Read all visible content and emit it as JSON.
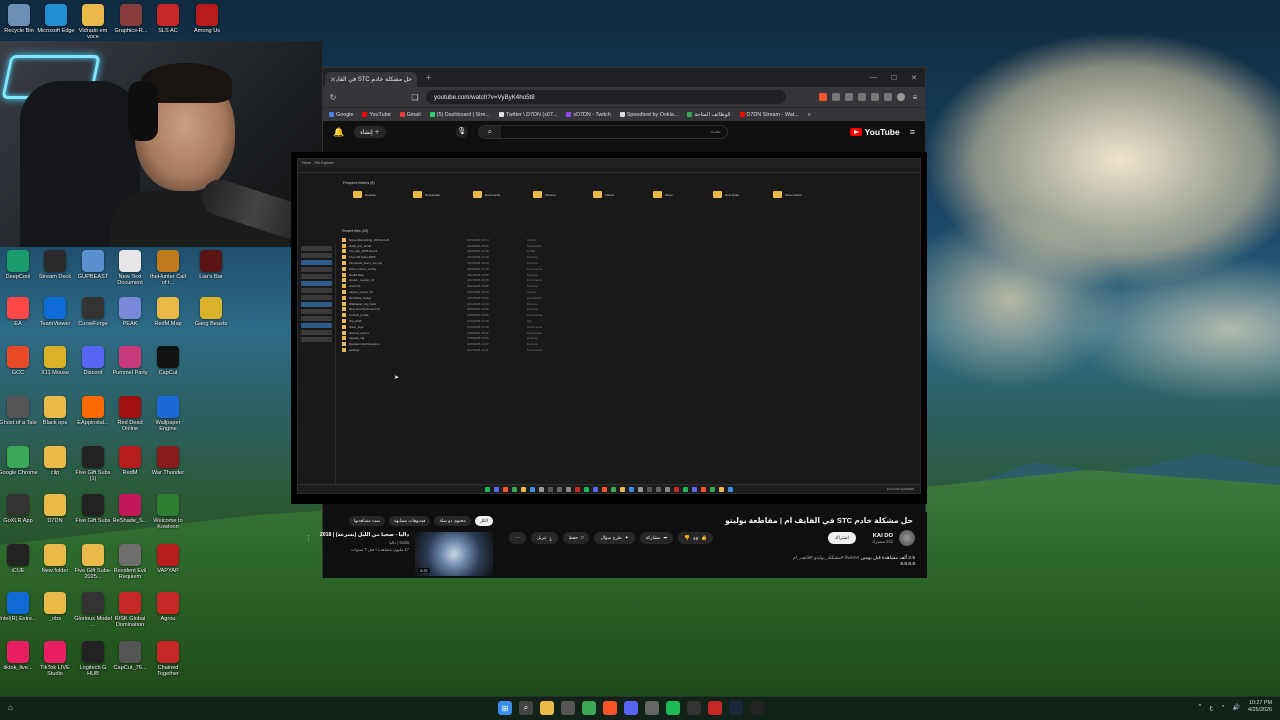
{
  "desktop": {
    "top_icons": [
      {
        "label": "Recycle Bin",
        "icon": "recycle-bin-icon",
        "color": "#6d8fb3"
      },
      {
        "label": "Microsoft Edge",
        "icon": "edge-icon",
        "color": "#1f8fd1"
      },
      {
        "label": "Vidrado em voce",
        "icon": "folder-icon",
        "color": "#e9b949"
      },
      {
        "label": "Graphics-R...",
        "icon": "graphics-icon",
        "color": "#8a3c3c"
      },
      {
        "label": "SLS AC",
        "icon": "sls-icon",
        "color": "#c62828"
      },
      {
        "label": "Among Us",
        "icon": "among-us-icon",
        "color": "#b71c1c"
      }
    ],
    "icons": [
      {
        "label": "DeepCool",
        "icon": "deepcool-icon",
        "color": "#1a9d6b"
      },
      {
        "label": "Stream Deck",
        "icon": "stream-deck-icon",
        "color": "#2a2a2a"
      },
      {
        "label": "GUPBEAST",
        "icon": "gupbeast-icon",
        "color": "#5a8fd0"
      },
      {
        "label": "New Text Document",
        "icon": "text-document-icon",
        "color": "#e6e6e6"
      },
      {
        "label": "theHunter Call of t...",
        "icon": "thehunter-icon",
        "color": "#c07a1b"
      },
      {
        "label": "Liar's Bar",
        "icon": "liars-bar-icon",
        "color": "#5a1414"
      },
      {
        "label": "EA",
        "icon": "ea-icon",
        "color": "#ff4747"
      },
      {
        "label": "TeamViewer",
        "icon": "teamviewer-icon",
        "color": "#0e6bd6"
      },
      {
        "label": "CurseForge",
        "icon": "curseforge-icon",
        "color": "#333333"
      },
      {
        "label": "PEAK",
        "icon": "peak-icon",
        "color": "#7a88d9"
      },
      {
        "label": "RedM.Map",
        "icon": "folder-icon",
        "color": "#e9b949"
      },
      {
        "label": "Gang Beasts",
        "icon": "gang-beasts-icon",
        "color": "#d9b22a"
      },
      {
        "label": "GCC",
        "icon": "gcc-icon",
        "color": "#e84a27"
      },
      {
        "label": "X11 Mouse",
        "icon": "mouse-icon",
        "color": "#d9b226"
      },
      {
        "label": "Discord",
        "icon": "discord-icon",
        "color": "#5865f2"
      },
      {
        "label": "Pummel Party",
        "icon": "pummel-party-icon",
        "color": "#c93a7a"
      },
      {
        "label": "CapCut",
        "icon": "capcut-icon",
        "color": "#111111"
      },
      {
        "label": "Ghost of a Tale",
        "icon": "ghost-of-a-tale-icon",
        "color": "#555555"
      },
      {
        "label": "Black ops",
        "icon": "folder-icon",
        "color": "#e9b949"
      },
      {
        "label": "EAppinstal...",
        "icon": "ea-app-icon",
        "color": "#ff6a00"
      },
      {
        "label": "Red Dead Online",
        "icon": "red-dead-icon",
        "color": "#a01010"
      },
      {
        "label": "Wallpaper Engine",
        "icon": "wallpaper-engine-icon",
        "color": "#1d6ad6"
      },
      {
        "label": "Google Chrome",
        "icon": "chrome-icon",
        "color": "#3aa757"
      },
      {
        "label": "clip",
        "icon": "folder-icon",
        "color": "#e9b949"
      },
      {
        "label": "Five Gift Subs (1)",
        "icon": "video-file-icon",
        "color": "#222222"
      },
      {
        "label": "RedM",
        "icon": "redm-icon",
        "color": "#b71c1c"
      },
      {
        "label": "War Thunder",
        "icon": "war-thunder-icon",
        "color": "#8a1a1a"
      },
      {
        "label": "GoXLR App",
        "icon": "goxlr-icon",
        "color": "#333333"
      },
      {
        "label": "D7DN",
        "icon": "folder-icon",
        "color": "#e9b949"
      },
      {
        "label": "Five Gift Subs",
        "icon": "video-file-icon",
        "color": "#222222"
      },
      {
        "label": "ReShade_S...",
        "icon": "reshade-icon",
        "color": "#c2185b"
      },
      {
        "label": "Welcome to Kowloon",
        "icon": "kowloon-icon",
        "color": "#2e7d32"
      },
      {
        "label": "iCUE",
        "icon": "icue-icon",
        "color": "#222222"
      },
      {
        "label": "New folder",
        "icon": "folder-icon",
        "color": "#e9b949"
      },
      {
        "label": "Five Gift Subs-2025...",
        "icon": "folder-icon",
        "color": "#e9b949"
      },
      {
        "label": "Resident Evil Requiem",
        "icon": "resident-evil-icon",
        "color": "#6e6e6e"
      },
      {
        "label": "VAPYAP",
        "icon": "vapyap-icon",
        "color": "#b71c1c"
      },
      {
        "label": "Intel(R) Extre...",
        "icon": "intel-icon",
        "color": "#0e6bd6"
      },
      {
        "label": "_obs",
        "icon": "folder-icon",
        "color": "#e9b949"
      },
      {
        "label": "Glorious Model ...",
        "icon": "glorious-icon",
        "color": "#333333"
      },
      {
        "label": "RISK Global Domination",
        "icon": "risk-icon",
        "color": "#c62828"
      },
      {
        "label": "Agrou",
        "icon": "agrou-icon",
        "color": "#c62828"
      },
      {
        "label": "tiktok_live...",
        "icon": "tiktok-icon",
        "color": "#e91e63"
      },
      {
        "label": "TikTok LIVE Studio",
        "icon": "tiktok-live-icon",
        "color": "#e91e63"
      },
      {
        "label": "Logitech G HUB",
        "icon": "logitech-icon",
        "color": "#222222"
      },
      {
        "label": "CapCut_76...",
        "icon": "capcut-icon",
        "color": "#555555"
      },
      {
        "label": "Chained Together",
        "icon": "chained-together-icon",
        "color": "#c62828"
      }
    ]
  },
  "browser": {
    "tab_title": "حل مشكلة خادم STC في الفايف ام",
    "url": "youtube.com/watch?v=VyByK4ho5t8",
    "bookmarks": [
      {
        "label": "Google",
        "color": "#4285f4"
      },
      {
        "label": "YouTube",
        "color": "#ff0000"
      },
      {
        "label": "Gmail",
        "color": "#ea4335"
      },
      {
        "label": "(5) Dashboard | Stre...",
        "color": "#2ecc71"
      },
      {
        "label": "Twitter \\ D7DN (x07...",
        "color": "#dddddd"
      },
      {
        "label": "xD7DN - Twitch",
        "color": "#9146ff"
      },
      {
        "label": "Speedtest by Ookla...",
        "color": "#dddddd"
      },
      {
        "label": "الوظائف المتاحة",
        "color": "#34a853"
      },
      {
        "label": "D7DN Stream - Wat...",
        "color": "#ff0000"
      }
    ]
  },
  "youtube": {
    "create_label": "إنشاء",
    "search_value": "بحث",
    "logo_text": "YouTube",
    "video_title": "حل مشكلة خادم STC في الفايف ام | مقاطعة بوليتو",
    "channel_name": "KAI DO",
    "channel_subs": "242 مشترك",
    "subscribe_label": "اشتراك",
    "likes": "48",
    "share_label": "مشاركة",
    "ask_label": "طرح سؤال",
    "save_label": "حفظ",
    "download_label": "تنزيل",
    "views": "2.5 ألف مشاهدة قبل يومين",
    "hashtags": "#fivem #مشكلة_بوليتو #فايف_ام",
    "desc_extra": "8.8.8.8",
    "chips": [
      "الكل",
      "محتوى ذو صلة",
      "فيديوهات مشابهة",
      "تمت مشاهدتها"
    ],
    "rec": {
      "title": "داليا - صحيا من الليل (بسرعة) | 2018",
      "channel": "Dalia | داليا",
      "stats": "17 مليون مشاهدة • قبل 7 سنوات",
      "duration": "3:37"
    }
  },
  "explorer": {
    "title": "Home - File Explorer",
    "quick_access_title": "Frequent folders (8)",
    "quick_access": [
      "Desktop",
      "Downloads",
      "Documents",
      "Pictures",
      "Videos",
      "Music",
      "New folder",
      "Screenshots"
    ],
    "recent_title": "Recent files (20)",
    "recent": [
      {
        "name": "ScreenRecording_2025-04-24",
        "date": "4/24/2025 10:14",
        "loc": "Videos"
      },
      {
        "name": "tiktok_live_studio",
        "date": "4/24/2025 09:51",
        "loc": "Downloads"
      },
      {
        "name": "obs_clip_2025-04-23",
        "date": "4/23/2025 22:40",
        "loc": "D7DN"
      },
      {
        "name": "Five Gift Subs-2025",
        "date": "4/23/2025 21:02",
        "loc": "Desktop"
      },
      {
        "name": "thumbnail_fivem_stc.png",
        "date": "4/23/2025 18:33",
        "loc": "Pictures"
      },
      {
        "name": "citizen_fivem_config",
        "date": "4/23/2025 17:10",
        "loc": "Documents"
      },
      {
        "name": "RedM.Map",
        "date": "4/22/2025 23:56",
        "loc": "Desktop"
      },
      {
        "name": "stream_overlay_v3",
        "date": "4/22/2025 20:15",
        "loc": "Documents"
      },
      {
        "name": "notes.txt",
        "date": "4/22/2025 19:48",
        "loc": "Desktop"
      },
      {
        "name": "capcut_export_76",
        "date": "4/22/2025 16:20",
        "loc": "Videos"
      },
      {
        "name": "ReShade_Setup",
        "date": "4/21/2025 14:02",
        "loc": "Downloads"
      },
      {
        "name": "Wallpaper_sky_field",
        "date": "4/21/2025 12:44",
        "loc": "Pictures"
      },
      {
        "name": "New Text Document.txt",
        "date": "4/20/2025 22:31",
        "loc": "Desktop"
      },
      {
        "name": "GoXLR_profile",
        "date": "4/20/2025 20:05",
        "loc": "Documents"
      },
      {
        "name": "clip_0419",
        "date": "4/19/2025 23:18",
        "loc": "clip"
      },
      {
        "name": "fivem_logs",
        "date": "4/19/2025 21:40",
        "loc": "Documents"
      },
      {
        "name": "discord_export",
        "date": "4/19/2025 18:12",
        "loc": "Downloads"
      },
      {
        "name": "vapyap_cfg",
        "date": "4/18/2025 15:50",
        "loc": "Desktop"
      },
      {
        "name": "Resident Evil Requiem",
        "date": "4/18/2025 13:27",
        "loc": "Desktop"
      },
      {
        "name": "settings",
        "date": "4/17/2025 11:03",
        "loc": "Documents"
      }
    ],
    "tray": "10:27 PM 4/25/2025"
  },
  "taskbar": {
    "apps": [
      {
        "icon": "start-icon",
        "color": "#3a8ee6"
      },
      {
        "icon": "search-icon",
        "color": "#444444"
      },
      {
        "icon": "file-explorer-icon",
        "color": "#e9b949"
      },
      {
        "icon": "taskview-icon",
        "color": "#555555"
      },
      {
        "icon": "chrome-icon",
        "color": "#3aa757"
      },
      {
        "icon": "brave-icon",
        "color": "#fb542b"
      },
      {
        "icon": "discord-icon",
        "color": "#5865f2"
      },
      {
        "icon": "app-icon",
        "color": "#666666"
      },
      {
        "icon": "spotify-icon",
        "color": "#1db954"
      },
      {
        "icon": "obs-icon",
        "color": "#333333"
      },
      {
        "icon": "sls-icon",
        "color": "#c62828"
      },
      {
        "icon": "steam-icon",
        "color": "#1b2838"
      },
      {
        "icon": "capcut-icon",
        "color": "#222222"
      }
    ],
    "lang": "ع",
    "time": "10:27 PM",
    "date": "4/25/2026"
  }
}
